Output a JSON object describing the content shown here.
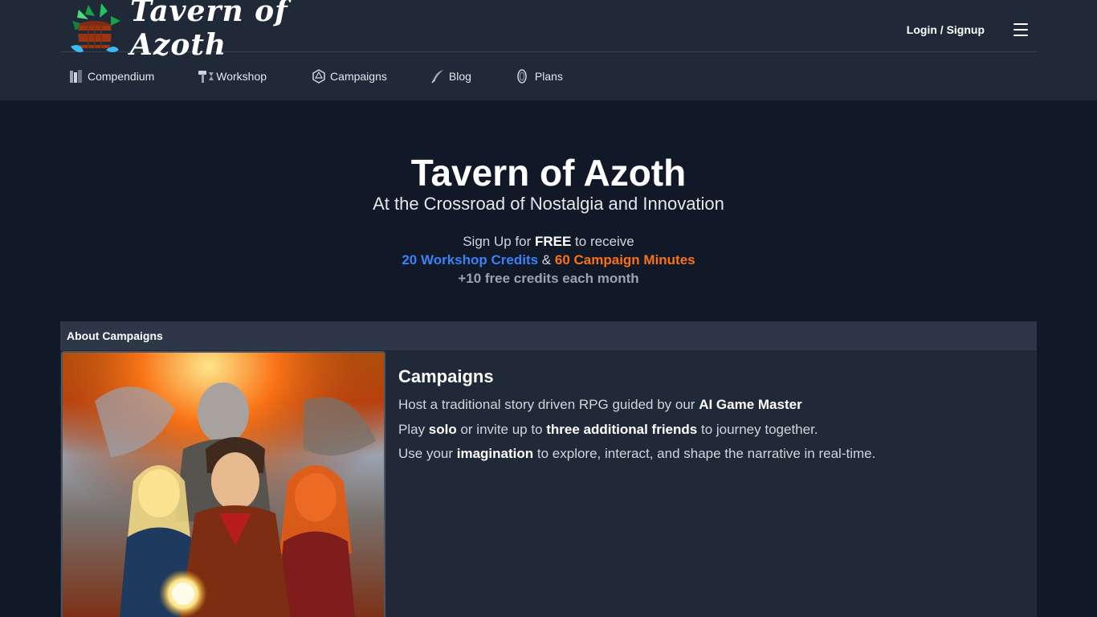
{
  "header": {
    "logo_text": "Tavern of Azoth",
    "login_label": "Login / Signup"
  },
  "nav": [
    {
      "label": "Compendium",
      "icon": "books-icon"
    },
    {
      "label": "Workshop",
      "icon": "hammer-icon"
    },
    {
      "label": "Campaigns",
      "icon": "d20-icon"
    },
    {
      "label": "Blog",
      "icon": "quill-icon"
    },
    {
      "label": "Plans",
      "icon": "coin-icon"
    }
  ],
  "hero": {
    "title": "Tavern of Azoth",
    "subtitle": "At the Crossroad of Nostalgia and Innovation",
    "signup_prefix": "Sign Up for ",
    "signup_free": "FREE",
    "signup_suffix": " to receive",
    "workshop_credits": "20 Workshop Credits",
    "amp": " & ",
    "campaign_minutes": "60 Campaign Minutes",
    "monthly": "+10 free credits each month"
  },
  "about": {
    "header": "About Campaigns",
    "title": "Campaigns",
    "line1_prefix": "Host a traditional story driven RPG guided by our ",
    "line1_bold": "AI Game Master",
    "line2_a": "Play ",
    "line2_b": "solo",
    "line2_c": " or invite up to ",
    "line2_d": "three additional friends",
    "line2_e": " to journey together.",
    "line3_a": "Use your ",
    "line3_b": "imagination",
    "line3_c": " to explore, interact, and shape the narrative in real-time."
  },
  "colors": {
    "page_bg": "#111827",
    "header_bg": "#1f2937",
    "accent_blue": "#3b82f6",
    "accent_orange": "#f97316"
  }
}
